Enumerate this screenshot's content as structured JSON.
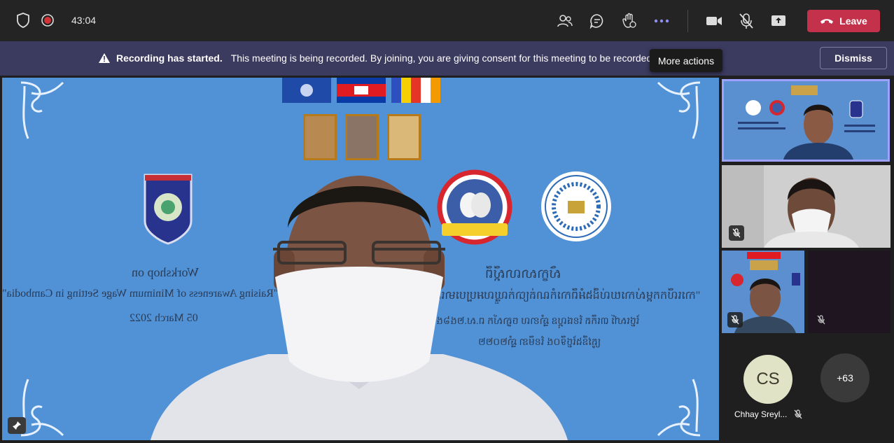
{
  "topbar": {
    "timer": "43:04",
    "leave_label": "Leave",
    "icons": [
      "shield-icon",
      "record-icon",
      "people-icon",
      "chat-icon",
      "raise-hand-icon",
      "more-icon",
      "camera-icon",
      "mic-off-icon",
      "share-icon",
      "phone-icon"
    ]
  },
  "banner": {
    "title": "Recording has started.",
    "message": "This meeting is being recorded. By joining, you are giving consent for this meeting to be recorded",
    "dismiss_label": "Dismiss"
  },
  "tooltip": {
    "label": "More actions"
  },
  "slide": {
    "workshop_title": "Workshop on",
    "workshop_subtitle": "\"Raising Awareness of Minimum Wage Setting in Cambodia\"",
    "workshop_date": "05 March 2022",
    "kh_line1": "សិក្ខាសាលាស្ដីពី",
    "kh_line2": "\"ការលើកកម្ពស់ការយល់ដឹងអំពីការកំណត់ប្រាក់ឈ្នួលអប្បបរមានៅកម្ពុជា\"",
    "kh_line3": "ថ្ងៃសៅរ៍ ៣កើត ខែផល្គុន ឆ្នាំខាល ចត្វាស័ក ព.ស.២៥៦៥",
    "kh_line4": "ត្រូវនឹងថ្ងៃទី០៥ ខែមីនា ឆ្នាំ២០២២"
  },
  "participants": {
    "tile_mute_icon": "mic-off-icon",
    "avatar_initials": "CS",
    "name": "Chhay Sreyl...",
    "more_count": "+63"
  },
  "colors": {
    "topbar": "#242424",
    "banner": "#3b3a5f",
    "leave": "#c4314b",
    "stage": "#5192d6",
    "active_border": "#9ea2ff"
  }
}
